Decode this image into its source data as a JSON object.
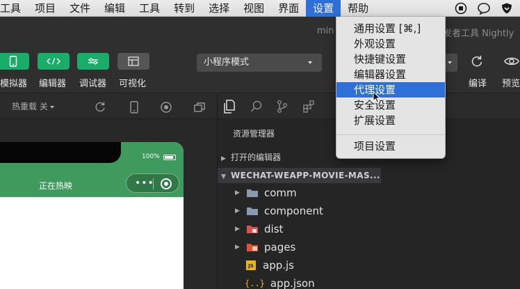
{
  "menubar": {
    "items": [
      "工具",
      "项目",
      "文件",
      "编辑",
      "工具",
      "转到",
      "选择",
      "视图",
      "界面",
      "设置",
      "帮助"
    ],
    "active_index": 9
  },
  "titlebar": {
    "title_fragment": "min",
    "title_right_fragment": "发者工具 Nightly"
  },
  "toolbar": {
    "buttons": [
      {
        "label": "模拟器",
        "icon": "phone-icon",
        "color": "#1aad6a"
      },
      {
        "label": "编辑器",
        "icon": "code-icon",
        "color": "#1aad6a"
      },
      {
        "label": "调试器",
        "icon": "debug-sliders-icon",
        "color": "#1aad6a"
      },
      {
        "label": "可视化",
        "icon": "layout-icon",
        "color": "#555555"
      }
    ],
    "mode_select": "小程序模式",
    "compile_label": "编译",
    "preview_label": "预览"
  },
  "simulator": {
    "hot_reload": "热重载 关",
    "battery": "100%",
    "nav_title": "正在热映",
    "nav_color": "#3f9a5e"
  },
  "explorer": {
    "title": "资源管理器",
    "open_editors": "打开的编辑器",
    "project": "WECHAT-WEAPP-MOVIE-MAS...",
    "tree": [
      {
        "name": "comm",
        "type": "folder"
      },
      {
        "name": "component",
        "type": "folder"
      },
      {
        "name": "dist",
        "type": "folder-red"
      },
      {
        "name": "pages",
        "type": "folder-red"
      },
      {
        "name": "app.js",
        "type": "js"
      },
      {
        "name": "app.json",
        "type": "json"
      }
    ]
  },
  "settings_menu": {
    "items": [
      "通用设置 [⌘,]",
      "外观设置",
      "快捷键设置",
      "编辑器设置",
      "代理设置",
      "安全设置",
      "扩展设置",
      "项目设置"
    ],
    "highlight_index": 4
  },
  "colors": {
    "accent": "#2f6fd8",
    "green": "#1aad6a"
  }
}
